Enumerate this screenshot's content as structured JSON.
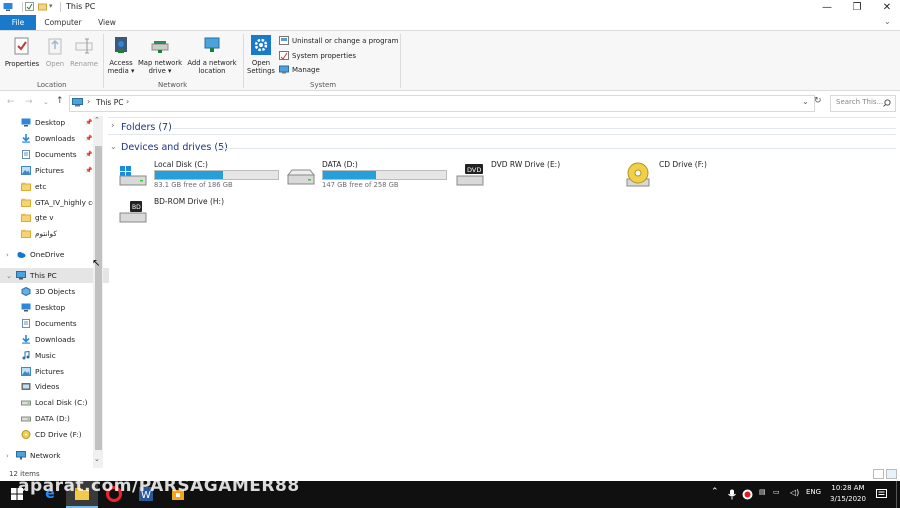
{
  "window": {
    "title": "This PC",
    "minimize": "—",
    "maximize": "❐",
    "close": "✕"
  },
  "ribbon_tabs": [
    "File",
    "Computer",
    "View"
  ],
  "ribbon": {
    "location": {
      "group_label": "Location",
      "properties": "Properties",
      "open": "Open",
      "rename": "Rename"
    },
    "network": {
      "group_label": "Network",
      "access_media_1": "Access",
      "access_media_2": "media ▾",
      "map_drive_1": "Map network",
      "map_drive_2": "drive ▾",
      "add_location_1": "Add a network",
      "add_location_2": "location"
    },
    "system": {
      "group_label": "System",
      "open_settings_1": "Open",
      "open_settings_2": "Settings",
      "uninstall": "Uninstall or change a program",
      "system_properties": "System properties",
      "manage": "Manage"
    }
  },
  "address": {
    "path": "This PC",
    "search_placeholder": "Search This..."
  },
  "nav": {
    "quick_access": [
      {
        "label": "Desktop",
        "icon": "desktop-icon",
        "pinned": true
      },
      {
        "label": "Downloads",
        "icon": "downloads-icon",
        "pinned": true
      },
      {
        "label": "Documents",
        "icon": "documents-icon",
        "pinned": true
      },
      {
        "label": "Pictures",
        "icon": "pictures-icon",
        "pinned": true
      },
      {
        "label": "etc",
        "icon": "folder-icon",
        "pinned": false
      },
      {
        "label": "GTA_IV_highly cc",
        "icon": "folder-icon",
        "pinned": false
      },
      {
        "label": "gte v",
        "icon": "folder-icon",
        "pinned": false
      },
      {
        "label": "كوانتوم",
        "icon": "folder-icon",
        "pinned": false
      }
    ],
    "onedrive": "OneDrive",
    "this_pc": "This PC",
    "this_pc_children": [
      {
        "label": "3D Objects",
        "icon": "3d-objects-icon"
      },
      {
        "label": "Desktop",
        "icon": "desktop-icon"
      },
      {
        "label": "Documents",
        "icon": "documents-icon"
      },
      {
        "label": "Downloads",
        "icon": "downloads-icon"
      },
      {
        "label": "Music",
        "icon": "music-icon"
      },
      {
        "label": "Pictures",
        "icon": "pictures-icon"
      },
      {
        "label": "Videos",
        "icon": "videos-icon"
      },
      {
        "label": "Local Disk (C:)",
        "icon": "drive-icon"
      },
      {
        "label": "DATA (D:)",
        "icon": "drive-icon"
      },
      {
        "label": "CD Drive (F:)",
        "icon": "cd-drive-icon"
      }
    ],
    "network": "Network"
  },
  "content": {
    "folders_header": "Folders (7)",
    "devices_header": "Devices and drives (5)",
    "drives": [
      {
        "name": "Local Disk (C:)",
        "free": "83.1 GB free of 186 GB",
        "used_fraction": 0.55,
        "icon": "windows-drive-icon"
      },
      {
        "name": "DATA (D:)",
        "free": "147 GB free of 258 GB",
        "used_fraction": 0.43,
        "icon": "hard-drive-icon"
      },
      {
        "name": "DVD RW Drive (E:)",
        "icon": "dvd-drive-icon"
      },
      {
        "name": "CD Drive (F:)",
        "icon": "cd-drive-icon"
      },
      {
        "name": "BD-ROM Drive (H:)",
        "icon": "bd-drive-icon"
      }
    ]
  },
  "status": {
    "items": "12 items"
  },
  "taskbar": {
    "time": "10:28 AM",
    "date": "3/15/2020",
    "lang": "ENG",
    "watermark": "aparat.com/PARSAGAMER88"
  },
  "colors": {
    "accent": "#1979ca",
    "drive_fill": "#26a0da",
    "header": "#1e3287"
  }
}
